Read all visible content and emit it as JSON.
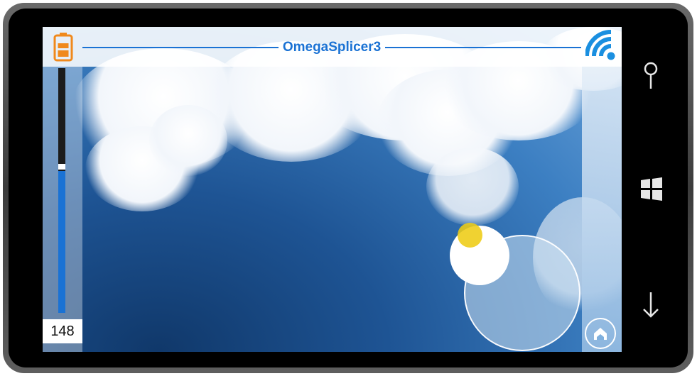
{
  "app": {
    "title": "OmegaSplicer3"
  },
  "throttle": {
    "value_label": "148",
    "level": 0.58
  },
  "icons": {
    "battery": "battery-icon",
    "wifi": "wifi-signal-icon",
    "home": "home-icon",
    "hardware_search": "search-icon",
    "hardware_start": "windows-start-icon",
    "hardware_back": "back-arrow-icon"
  },
  "colors": {
    "accent": "#1a72d4",
    "battery": "#f0891c",
    "joystick_dot": "#eecc14"
  }
}
